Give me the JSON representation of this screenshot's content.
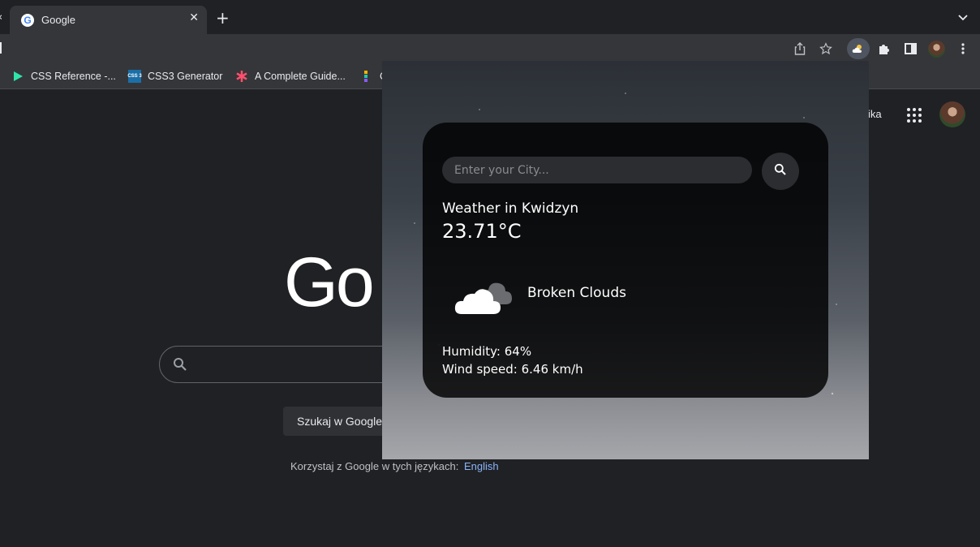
{
  "browser": {
    "tab": {
      "title": "Google"
    },
    "bookmarks": [
      {
        "label": "CSS Reference -..."
      },
      {
        "label": "CSS3 Generator",
        "icon_text": "CSS 3"
      },
      {
        "label": "A Complete Guide..."
      },
      {
        "label": "C"
      }
    ],
    "toolbar_icons": [
      "share-icon",
      "star-icon",
      "weather-extension-icon",
      "puzzle-icon",
      "sidepanel-icon",
      "avatar",
      "kebab-menu-icon"
    ]
  },
  "google": {
    "logo_text": "Go",
    "signin_fragment": "ika",
    "search_button": "Szukaj w Google",
    "lang_prefix": "Korzystaj z Google w tych językach:",
    "lang_link": "English"
  },
  "weather": {
    "placeholder": "Enter your City...",
    "heading": "Weather in Kwidzyn",
    "temperature": "23.71°C",
    "description": "Broken Clouds",
    "humidity": "Humidity: 64%",
    "wind": "Wind speed: 6.46 km/h",
    "icon": "broken-clouds-icon"
  },
  "colors": {
    "page_bg": "#202124",
    "chrome_bg": "#35363a",
    "link": "#8ab4f8",
    "card_bg": "rgba(0,0,0,0.82)"
  }
}
